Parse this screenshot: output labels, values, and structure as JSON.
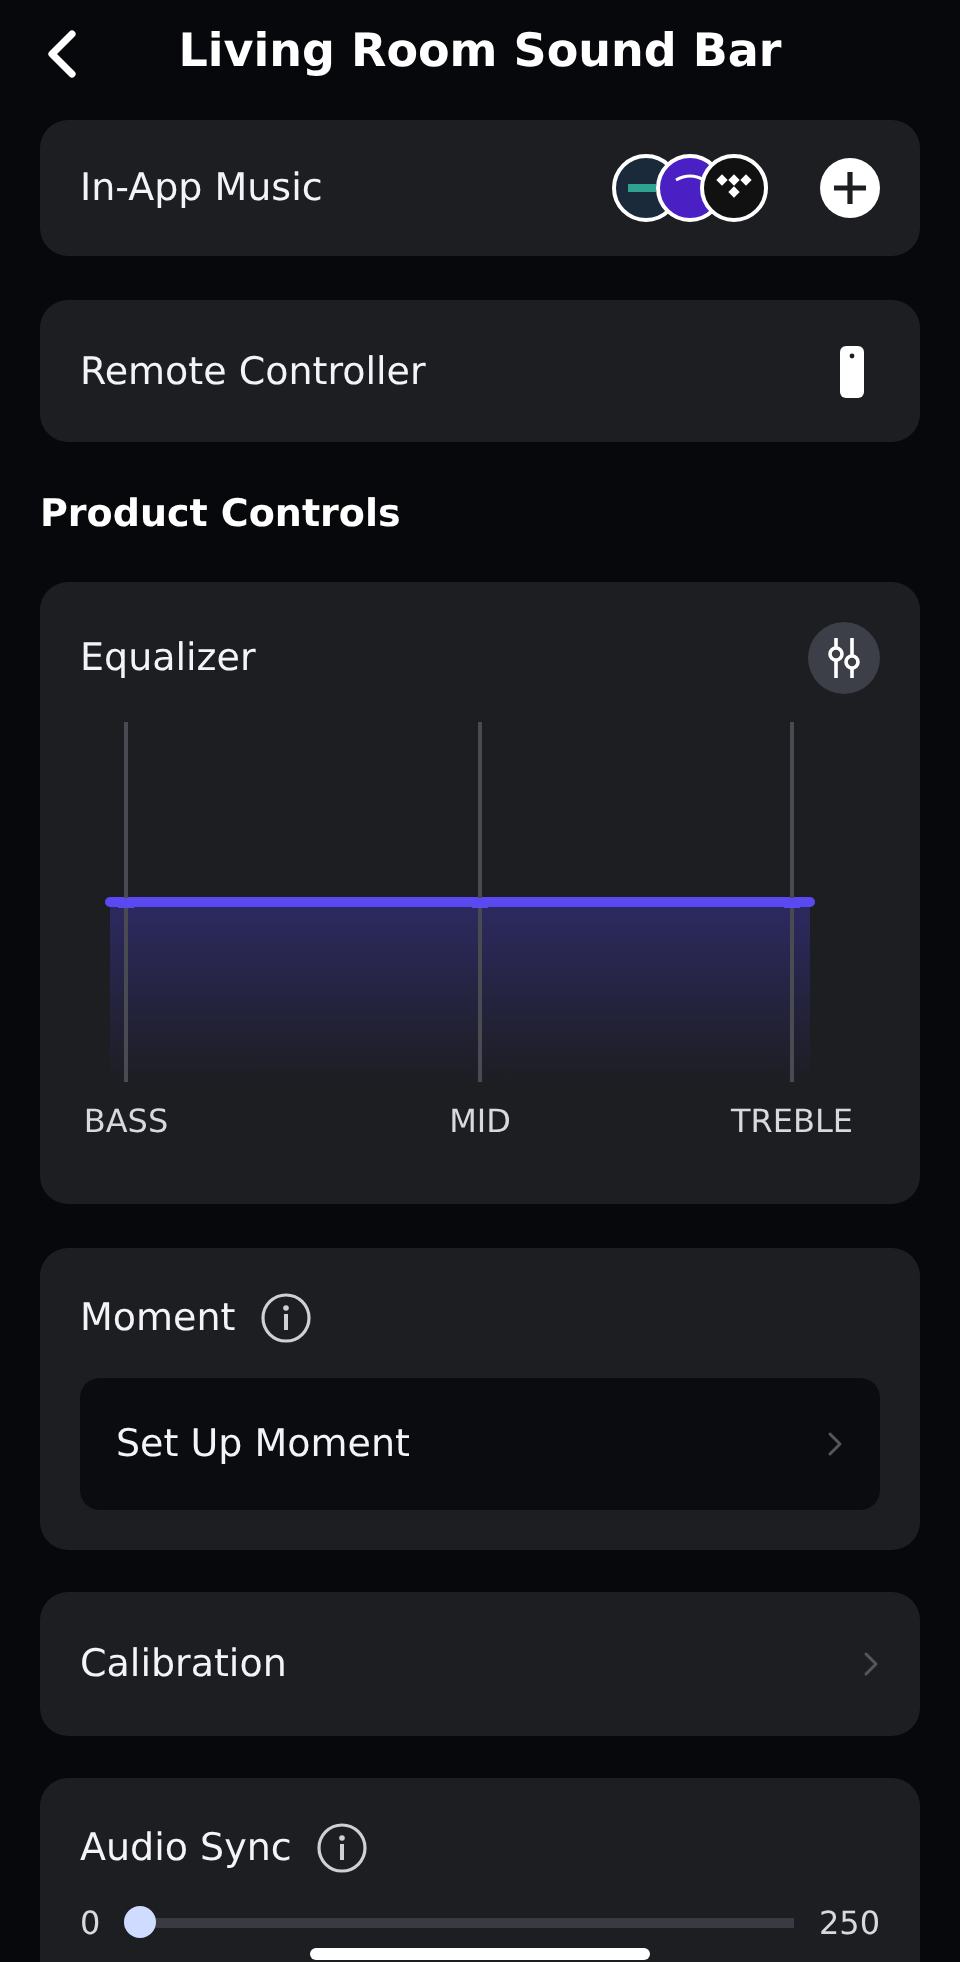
{
  "title": "Living Room Sound Bar",
  "sections": [
    {
      "kind": "services",
      "label": "In-App Music"
    },
    {
      "kind": "remote",
      "label": "Remote Controller"
    },
    {
      "kind": "heading",
      "label": "Product Controls"
    },
    {
      "kind": "equalizer",
      "title": "Equalizer",
      "bands": [
        {
          "label": "BASS",
          "level": 0.5
        },
        {
          "label": "MID",
          "level": 0.5
        },
        {
          "label": "TREBLE",
          "level": 0.5
        }
      ]
    },
    {
      "kind": "moment",
      "title": "Moment",
      "action": "Set Up Moment"
    },
    {
      "kind": "link",
      "label": "Calibration"
    },
    {
      "kind": "slider",
      "title": "Audio Sync",
      "min": "0",
      "max": "250",
      "level": 0
    }
  ]
}
